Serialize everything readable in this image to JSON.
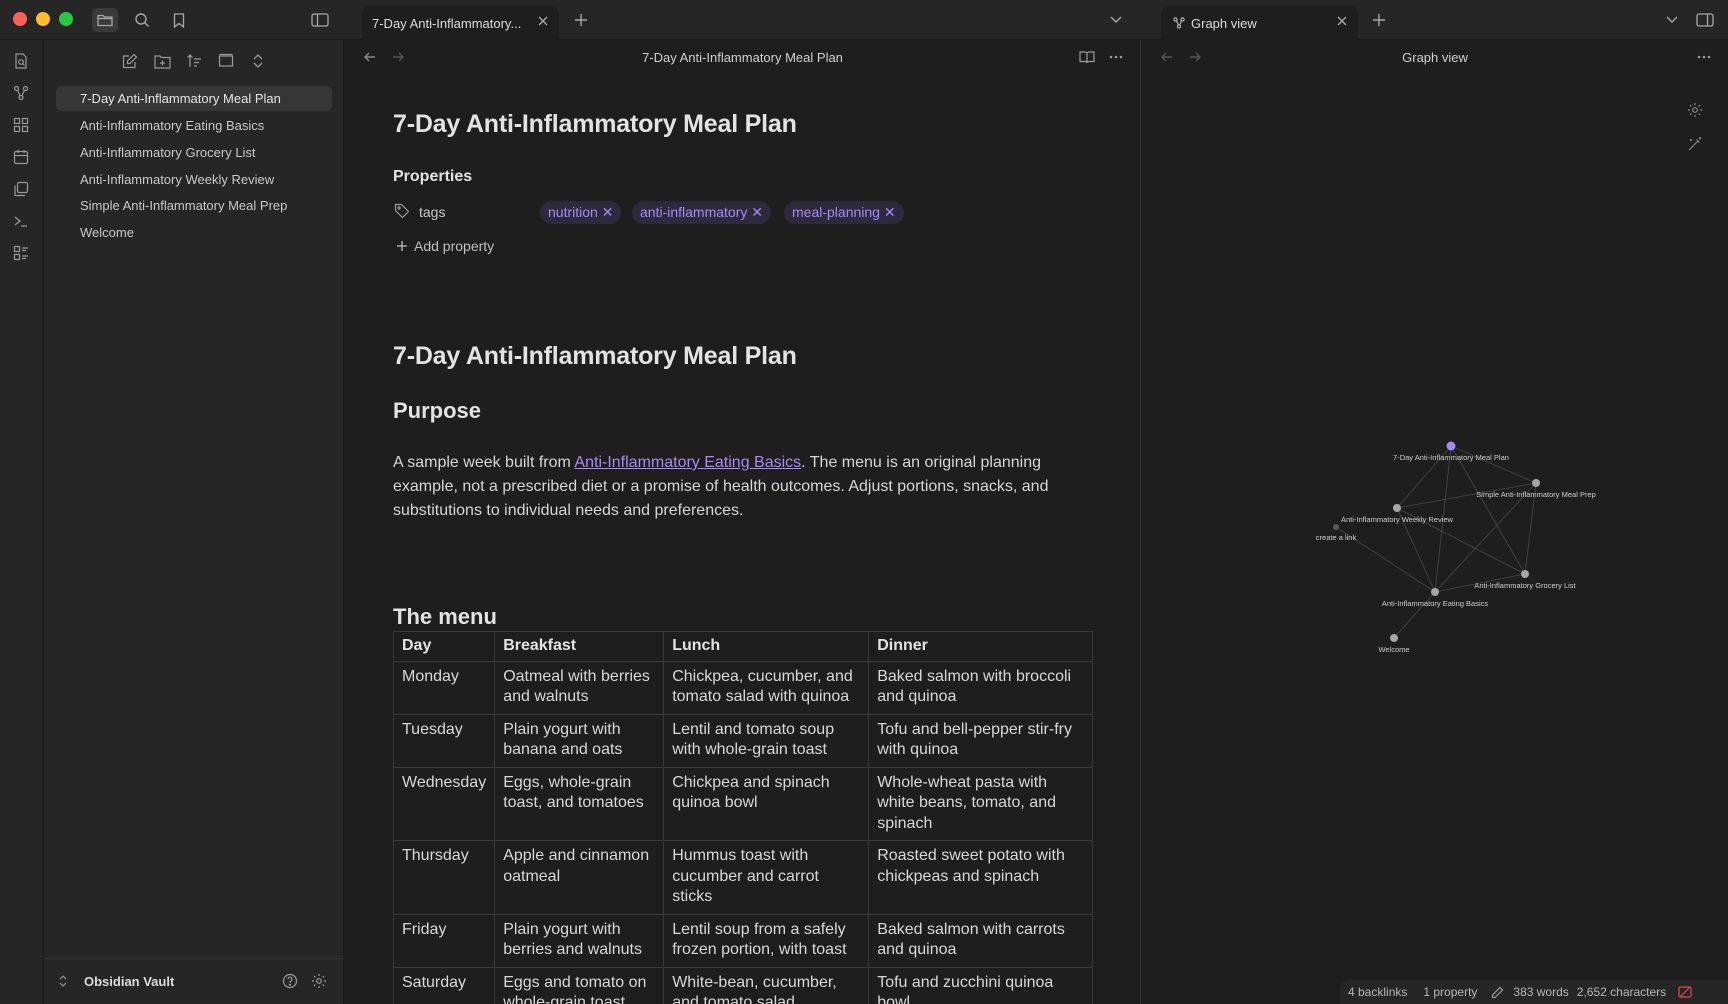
{
  "window": {
    "tabs": [
      {
        "label": "7-Day Anti-Inflammatory..."
      },
      {
        "label": "Graph view"
      }
    ]
  },
  "sidebar": {
    "files": [
      {
        "label": "7-Day Anti-Inflammatory Meal Plan",
        "active": true
      },
      {
        "label": "Anti-Inflammatory Eating Basics"
      },
      {
        "label": "Anti-Inflammatory Grocery List"
      },
      {
        "label": "Anti-Inflammatory Weekly Review"
      },
      {
        "label": "Simple Anti-Inflammatory Meal Prep"
      },
      {
        "label": "Welcome"
      }
    ],
    "vault_name": "Obsidian Vault"
  },
  "editor": {
    "view_title": "7-Day Anti-Inflammatory Meal Plan",
    "inline_title": "7-Day Anti-Inflammatory Meal Plan",
    "properties": {
      "label": "Properties",
      "tags_key": "tags",
      "tags": [
        "nutrition",
        "anti-inflammatory",
        "meal-planning"
      ],
      "add_property": "Add property"
    },
    "heading1": "7-Day Anti-Inflammatory Meal Plan",
    "heading_purpose": "Purpose",
    "purpose_before": "A sample week built from ",
    "purpose_link": "Anti-Inflammatory Eating Basics",
    "purpose_after": ". The menu is an original planning example, not a prescribed diet or a promise of health outcomes. Adjust portions, snacks, and substitutions to individual needs and preferences.",
    "heading_menu": "The menu",
    "table": {
      "headers": [
        "Day",
        "Breakfast",
        "Lunch",
        "Dinner"
      ],
      "rows": [
        [
          "Monday",
          "Oatmeal with berries and walnuts",
          "Chickpea, cucumber, and tomato salad with quinoa",
          "Baked salmon with broccoli and quinoa"
        ],
        [
          "Tuesday",
          "Plain yogurt with banana and oats",
          "Lentil and tomato soup with whole-grain toast",
          "Tofu and bell-pepper stir-fry with quinoa"
        ],
        [
          "Wednesday",
          "Eggs, whole-grain toast, and tomatoes",
          "Chickpea and spinach quinoa bowl",
          "Whole-wheat pasta with white beans, tomato, and spinach"
        ],
        [
          "Thursday",
          "Apple and cinnamon oatmeal",
          "Hummus toast with cucumber and carrot sticks",
          "Roasted sweet potato with chickpeas and spinach"
        ],
        [
          "Friday",
          "Plain yogurt with berries and walnuts",
          "Lentil soup from a safely frozen portion, with toast",
          "Baked salmon with carrots and quinoa"
        ],
        [
          "Saturday",
          "Eggs and tomato on whole-grain toast",
          "White-bean, cucumber, and tomato salad",
          "Tofu and zucchini quinoa bowl"
        ]
      ]
    }
  },
  "graph": {
    "view_title": "Graph view",
    "nodes": [
      {
        "label": "7-Day Anti-Inflammatory Meal Plan",
        "active": true
      },
      {
        "label": "Simple Anti-Inflammatory Meal Prep"
      },
      {
        "label": "Anti-Inflammatory Weekly Review"
      },
      {
        "label": "create a link",
        "unresolved": true
      },
      {
        "label": "Anti-Inflammatory Grocery List"
      },
      {
        "label": "Anti-Inflammatory Eating Basics"
      },
      {
        "label": "Welcome"
      }
    ],
    "accent_color": "#a58bf5"
  },
  "status": {
    "backlinks": "4 backlinks",
    "properties": "1 property",
    "words": "383 words",
    "characters": "2,652 characters"
  }
}
